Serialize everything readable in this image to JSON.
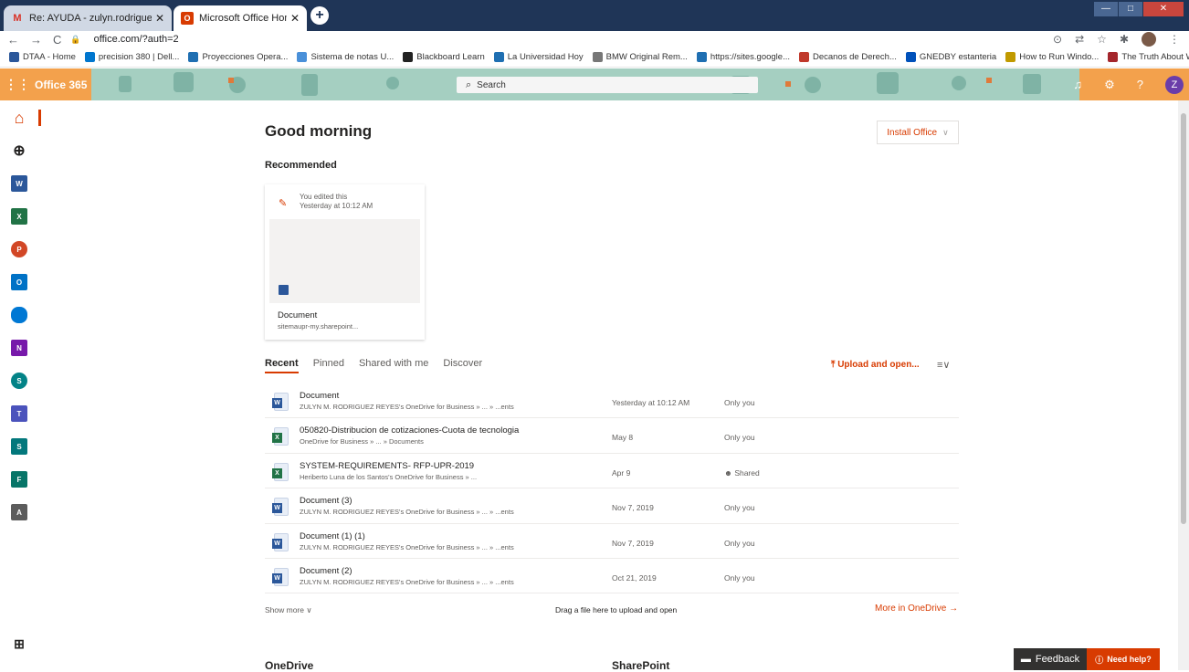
{
  "browser": {
    "tabs": [
      {
        "title": "Re: AYUDA - zulyn.rodriguez@u",
        "favicon": "gmail-icon"
      },
      {
        "title": "Microsoft Office Home",
        "favicon": "office-icon"
      }
    ],
    "url": "office.com/?auth=2",
    "bookmarks": [
      {
        "label": "DTAA - Home",
        "color": "#2b579a"
      },
      {
        "label": "precision 380 | Dell...",
        "color": "#0076ce"
      },
      {
        "label": "Proyecciones Opera...",
        "color": "#1f6fb2"
      },
      {
        "label": "Sistema de notas U...",
        "color": "#4a90d9"
      },
      {
        "label": "Blackboard Learn",
        "color": "#222222"
      },
      {
        "label": "La Universidad Hoy",
        "color": "#1f6fb2"
      },
      {
        "label": "BMW Original Rem...",
        "color": "#777777"
      },
      {
        "label": "https://sites.google...",
        "color": "#1f6fb2"
      },
      {
        "label": "Decanos de Derech...",
        "color": "#c0392b"
      },
      {
        "label": "GNEDBY estanteria",
        "color": "#0051ba"
      },
      {
        "label": "How to Run Windo...",
        "color": "#c19a00"
      },
      {
        "label": "The Truth About W...",
        "color": "#a4262c"
      }
    ],
    "bookmarks_more": "»"
  },
  "header": {
    "brand": "Office 365",
    "search_placeholder": "Search",
    "avatar_initial": "Z",
    "colors": {
      "accent": "#d83b01",
      "bar": "#f3a14c"
    }
  },
  "main": {
    "greeting": "Good morning",
    "install_label": "Install Office",
    "recommended_title": "Recommended",
    "card": {
      "activity": "You edited this",
      "time": "Yesterday at 10:12 AM",
      "name": "Document",
      "location": "sitemaupr-my.sharepoint..."
    },
    "tabs": [
      "Recent",
      "Pinned",
      "Shared with me",
      "Discover"
    ],
    "upload_label": "Upload and open...",
    "files": [
      {
        "type": "word",
        "name": "Document",
        "path": "ZULYN M. RODRIGUEZ REYES's OneDrive for Business » ... » ...ents",
        "date": "Yesterday at 10:12 AM",
        "sharing": "Only you"
      },
      {
        "type": "excel",
        "name": "050820-Distribucion de cotizaciones-Cuota de tecnologia",
        "path": "OneDrive for Business » ... » Documents",
        "date": "May 8",
        "sharing": "Only you"
      },
      {
        "type": "excel",
        "name": "SYSTEM-REQUIREMENTS- RFP-UPR-2019",
        "path": "Heriberto Luna de los Santos's OneDrive for Business » ...",
        "date": "Apr 9",
        "sharing": "Shared"
      },
      {
        "type": "word",
        "name": "Document (3)",
        "path": "ZULYN M. RODRIGUEZ REYES's OneDrive for Business » ... » ...ents",
        "date": "Nov 7, 2019",
        "sharing": "Only you"
      },
      {
        "type": "word",
        "name": "Document (1) (1)",
        "path": "ZULYN M. RODRIGUEZ REYES's OneDrive for Business » ... » ...ents",
        "date": "Nov 7, 2019",
        "sharing": "Only you"
      },
      {
        "type": "word",
        "name": "Document (2)",
        "path": "ZULYN M. RODRIGUEZ REYES's OneDrive for Business » ... » ...ents",
        "date": "Oct 21, 2019",
        "sharing": "Only you"
      }
    ],
    "show_more": "Show more",
    "drag_hint": "Drag a file here to upload and open",
    "more_onedrive": "More in OneDrive",
    "section_onedrive": "OneDrive",
    "section_sharepoint": "SharePoint"
  },
  "footer": {
    "feedback": "Feedback",
    "need_help": "Need help?"
  }
}
